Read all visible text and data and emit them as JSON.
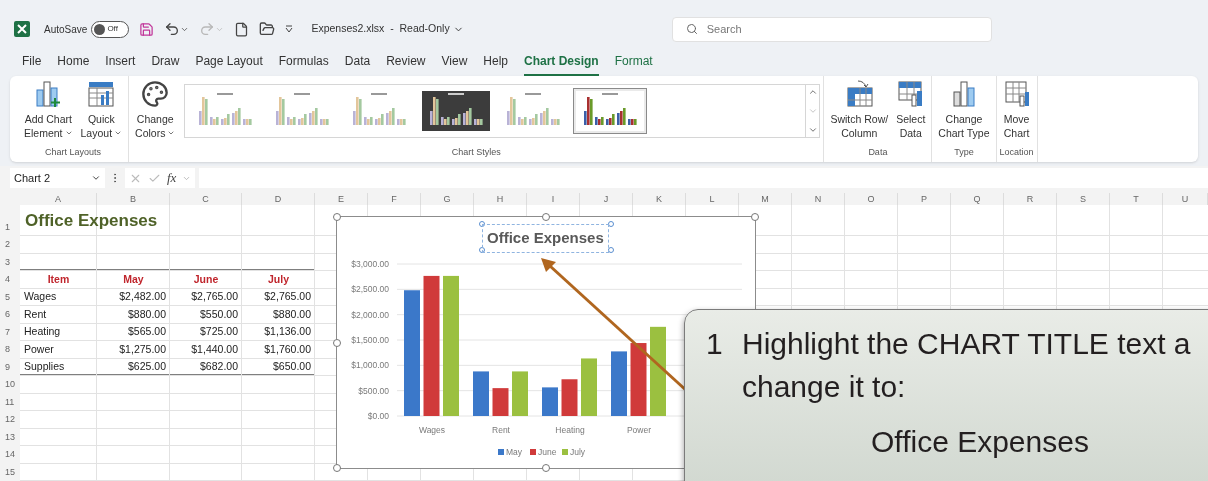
{
  "title_bar": {
    "autosave_label": "AutoSave",
    "autosave": {
      "on": false,
      "label": "Off"
    },
    "quick_access": [
      {
        "kind": "save",
        "disabled": false
      },
      {
        "kind": "undo",
        "disabled": false
      },
      {
        "kind": "redo",
        "disabled": true
      },
      {
        "kind": "new",
        "disabled": false
      },
      {
        "kind": "open",
        "disabled": false
      },
      {
        "kind": "customize",
        "disabled": false
      }
    ],
    "file_title": "Expenses2.xlsx  -  Read-Only"
  },
  "search": {
    "placeholder": "Search"
  },
  "tabs": [
    {
      "label": "File",
      "selected": false,
      "contextual": false
    },
    {
      "label": "Home",
      "selected": false,
      "contextual": false
    },
    {
      "label": "Insert",
      "selected": false,
      "contextual": false
    },
    {
      "label": "Draw",
      "selected": false,
      "contextual": false
    },
    {
      "label": "Page Layout",
      "selected": false,
      "contextual": false
    },
    {
      "label": "Formulas",
      "selected": false,
      "contextual": false
    },
    {
      "label": "Data",
      "selected": false,
      "contextual": false
    },
    {
      "label": "Review",
      "selected": false,
      "contextual": false
    },
    {
      "label": "View",
      "selected": false,
      "contextual": false
    },
    {
      "label": "Help",
      "selected": false,
      "contextual": false
    },
    {
      "label": "Chart Design",
      "selected": true,
      "contextual": true
    },
    {
      "label": "Format",
      "selected": false,
      "contextual": true
    }
  ],
  "ribbon": {
    "groups": [
      {
        "label": "Chart Layouts",
        "buttons": [
          {
            "kind": "add-element",
            "lines": [
              "Add Chart",
              "Element"
            ],
            "dropdown": true
          },
          {
            "kind": "quick-layout",
            "lines": [
              "Quick",
              "Layout"
            ],
            "dropdown": true
          }
        ]
      },
      {
        "label": "Chart Styles",
        "buttons": [
          {
            "kind": "palette",
            "lines": [
              "Change",
              "Colors"
            ],
            "dropdown": true
          }
        ],
        "gallery": [
          {
            "kind": "light",
            "selected": false
          },
          {
            "kind": "light",
            "selected": false
          },
          {
            "kind": "light",
            "selected": false
          },
          {
            "kind": "dark",
            "selected": false
          },
          {
            "kind": "light",
            "selected": false
          },
          {
            "kind": "light",
            "selected": true
          }
        ]
      },
      {
        "label": "Data",
        "buttons": [
          {
            "kind": "switch",
            "lines": [
              "Switch Row/",
              "Column"
            ],
            "dropdown": false
          },
          {
            "kind": "select-data",
            "lines": [
              "Select",
              "Data"
            ],
            "dropdown": false
          }
        ]
      },
      {
        "label": "Type",
        "buttons": [
          {
            "kind": "chart-type",
            "lines": [
              "Change",
              "Chart Type"
            ],
            "dropdown": false
          }
        ]
      },
      {
        "label": "Location",
        "buttons": [
          {
            "kind": "move",
            "lines": [
              "Move",
              "Chart"
            ],
            "dropdown": false
          }
        ]
      }
    ]
  },
  "formula_bar": {
    "name_box": "Chart 2",
    "fx": "fx"
  },
  "sheet": {
    "columns": [
      "A",
      "B",
      "C",
      "D",
      "E",
      "F",
      "G",
      "H",
      "I",
      "J",
      "K",
      "L",
      "M",
      "N",
      "O",
      "P",
      "Q",
      "R",
      "S",
      "T",
      "U"
    ],
    "rows": [
      "1",
      "2",
      "3",
      "4",
      "5",
      "6",
      "7",
      "8",
      "9",
      "10",
      "11",
      "12",
      "13",
      "14",
      "15"
    ],
    "title": "Office Expenses",
    "table": {
      "columns": [
        "Item",
        "May",
        "June",
        "July"
      ],
      "rows": [
        [
          "Wages",
          "$2,482.00",
          "$2,765.00",
          "$2,765.00"
        ],
        [
          "Rent",
          "$880.00",
          "$550.00",
          "$880.00"
        ],
        [
          "Heating",
          "$565.00",
          "$725.00",
          "$1,136.00"
        ],
        [
          "Power",
          "$1,275.00",
          "$1,440.00",
          "$1,760.00"
        ],
        [
          "Supplies",
          "$625.00",
          "$682.00",
          "$650.00"
        ]
      ]
    }
  },
  "chart": {
    "selected": true,
    "title_selected": true,
    "chart_data": {
      "type": "bar",
      "title": "Office Expenses",
      "categories": [
        "Wages",
        "Rent",
        "Heating",
        "Power"
      ],
      "series": [
        {
          "name": "May",
          "color": "#3b78c9",
          "values": [
            2482,
            880,
            565,
            1275
          ]
        },
        {
          "name": "June",
          "color": "#d03a3a",
          "values": [
            2765,
            550,
            725,
            1440
          ]
        },
        {
          "name": "July",
          "color": "#9bc040",
          "values": [
            2765,
            880,
            1136,
            1760
          ]
        }
      ],
      "grid": true,
      "legend": "bottom",
      "ylim": [
        0,
        3000
      ],
      "yticks": [
        {
          "value": 0,
          "label": "$0.00"
        },
        {
          "value": 500,
          "label": "$500.00"
        },
        {
          "value": 1000,
          "label": "$1,000.00"
        },
        {
          "value": 1500,
          "label": "$1,500.00"
        },
        {
          "value": 2000,
          "label": "$2,000.00"
        },
        {
          "value": 2500,
          "label": "$2,500.00"
        },
        {
          "value": 3000,
          "label": "$3,000.00"
        }
      ]
    }
  },
  "callout": {
    "number": "1",
    "lines": [
      "Highlight the CHART TITLE text a",
      "change it to:"
    ],
    "value": "Office Expenses"
  }
}
